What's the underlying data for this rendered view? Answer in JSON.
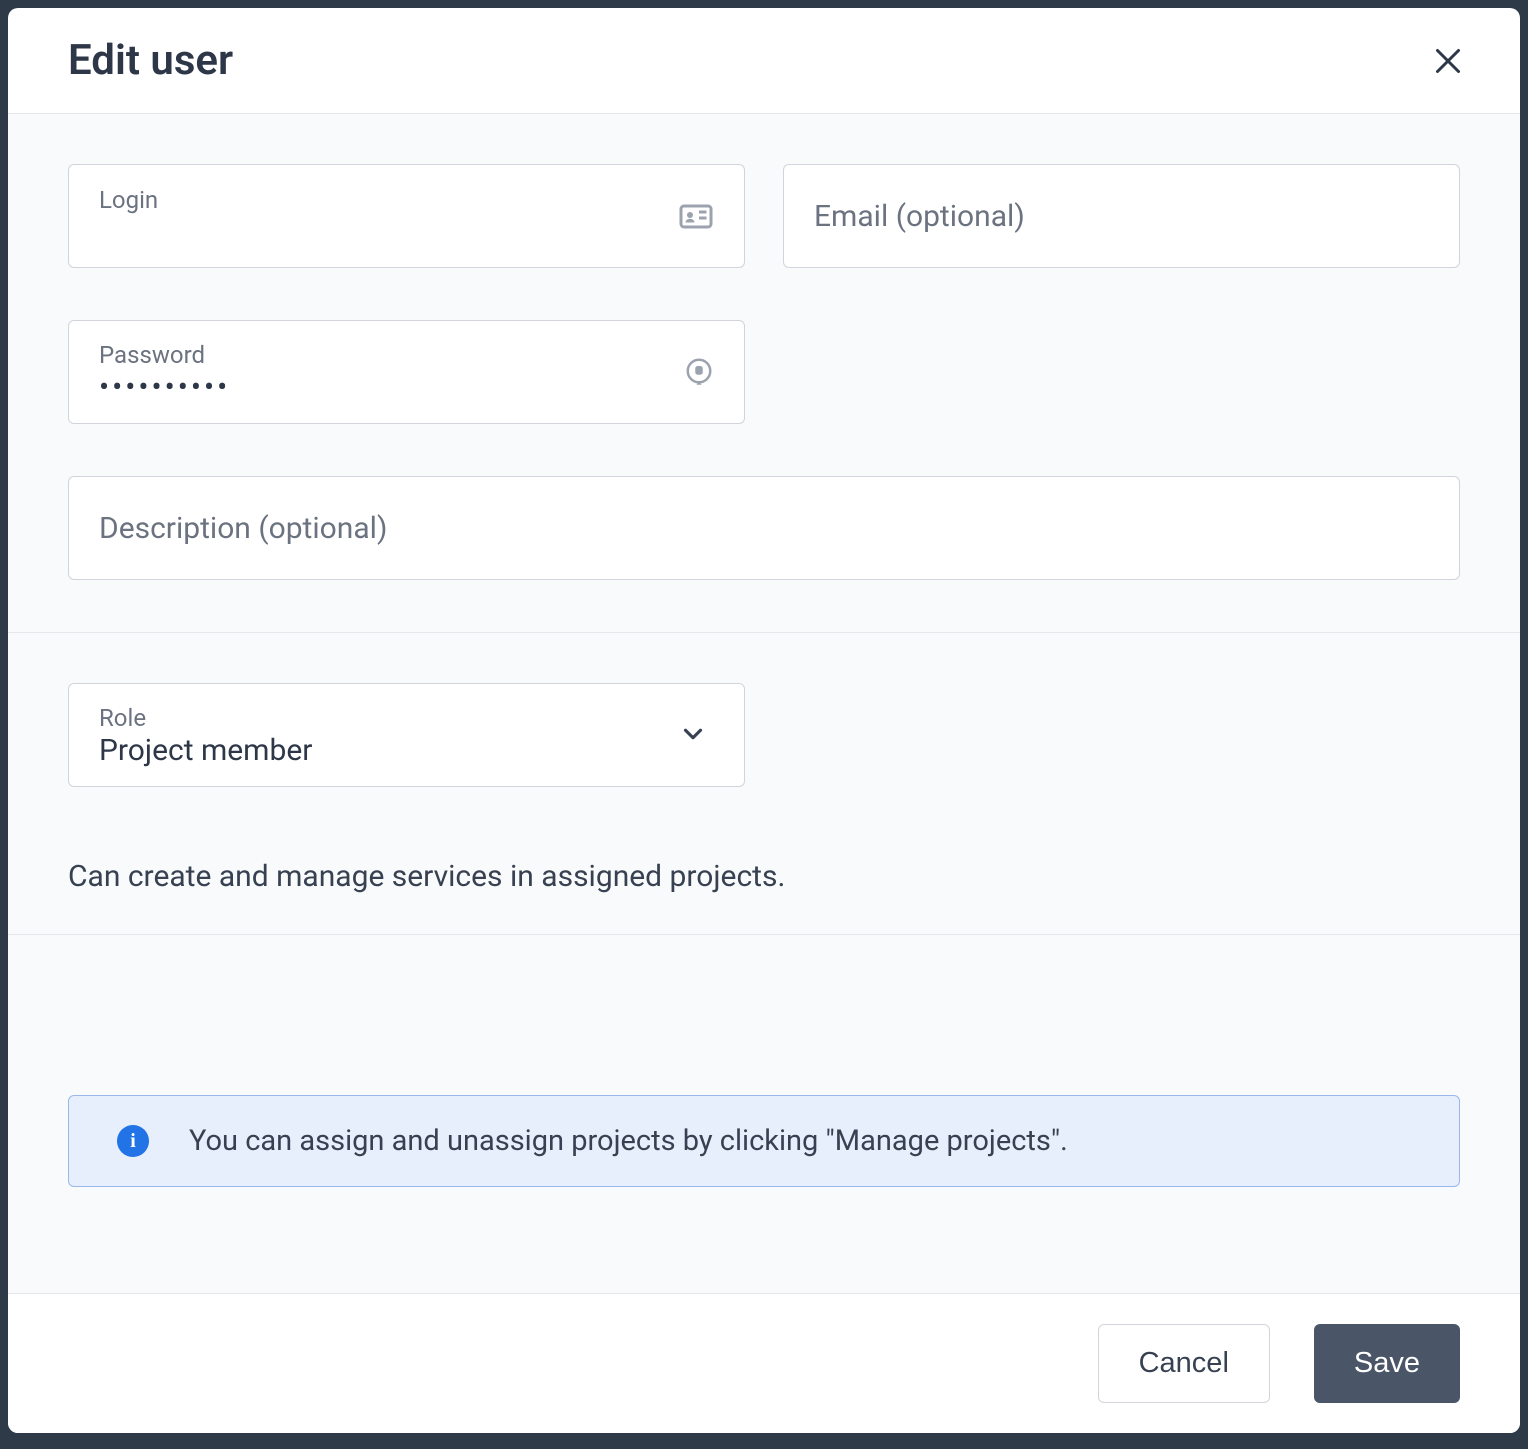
{
  "header": {
    "title": "Edit user"
  },
  "fields": {
    "login": {
      "label": "Login",
      "value": ""
    },
    "email": {
      "placeholder": "Email (optional)"
    },
    "password": {
      "label": "Password",
      "value": "••••••••••"
    },
    "description": {
      "placeholder": "Description (optional)"
    },
    "role": {
      "label": "Role",
      "value": "Project member"
    }
  },
  "roleDescription": "Can create and manage services in assigned projects.",
  "infoBanner": {
    "text": "You can assign and unassign projects by clicking \"Manage projects\"."
  },
  "footer": {
    "cancel": "Cancel",
    "save": "Save"
  }
}
